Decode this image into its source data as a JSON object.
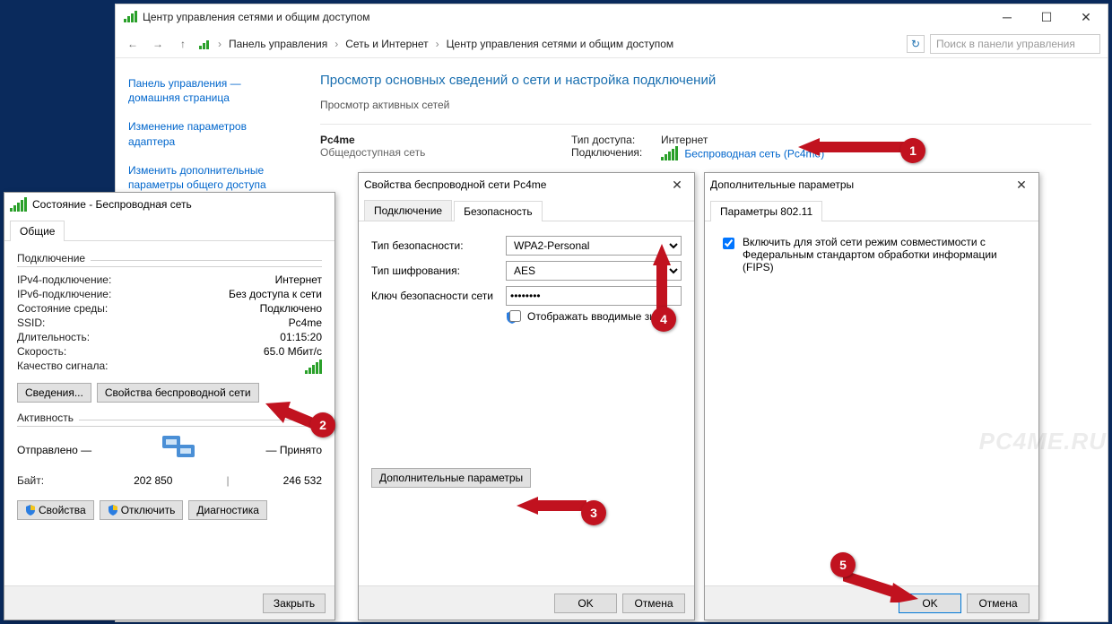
{
  "mainWindow": {
    "title": "Центр управления сетями и общим доступом",
    "breadcrumb": {
      "p1": "Панель управления",
      "p2": "Сеть и Интернет",
      "p3": "Центр управления сетями и общим доступом"
    },
    "searchPlaceholder": "Поиск в панели управления",
    "sideLinks": {
      "home": "Панель управления — домашняя страница",
      "adapter": "Изменение параметров адаптера",
      "sharing": "Изменить дополнительные параметры общего доступа"
    },
    "heading": "Просмотр основных сведений о сети и настройка подключений",
    "activeHeading": "Просмотр активных сетей",
    "network": {
      "name": "Pc4me",
      "scope": "Общедоступная сеть",
      "accessLabel": "Тип доступа:",
      "accessValue": "Интернет",
      "connLabel": "Подключения:",
      "connValue": "Беспроводная сеть (Pc4me)"
    }
  },
  "statusDlg": {
    "title": "Состояние - Беспроводная сеть",
    "tab": "Общие",
    "groupConn": "Подключение",
    "rows": {
      "ipv4k": "IPv4-подключение:",
      "ipv4v": "Интернет",
      "ipv6k": "IPv6-подключение:",
      "ipv6v": "Без доступа к сети",
      "statek": "Состояние среды:",
      "statev": "Подключено",
      "ssidk": "SSID:",
      "ssidv": "Pc4me",
      "durk": "Длительность:",
      "durv": "01:15:20",
      "speedk": "Скорость:",
      "speedv": "65.0 Мбит/с",
      "qualk": "Качество сигнала:"
    },
    "btnDetails": "Сведения...",
    "btnWlanProps": "Свойства беспроводной сети",
    "groupAct": "Активность",
    "sentLabel": "Отправлено",
    "recvLabel": "Принято",
    "bytesLabel": "Байт:",
    "sent": "202 850",
    "recv": "246 532",
    "btnProps": "Свойства",
    "btnDisable": "Отключить",
    "btnDiag": "Диагностика",
    "btnClose": "Закрыть"
  },
  "propsDlg": {
    "title": "Свойства беспроводной сети Pc4me",
    "tabConn": "Подключение",
    "tabSec": "Безопасность",
    "secTypeLabel": "Тип безопасности:",
    "secTypeVal": "WPA2-Personal",
    "encLabel": "Тип шифрования:",
    "encVal": "AES",
    "keyLabel": "Ключ безопасности сети",
    "keyVal": "••••••••",
    "showChars": "Отображать вводимые знаки",
    "btnAdvanced": "Дополнительные параметры",
    "btnOK": "OK",
    "btnCancel": "Отмена"
  },
  "advDlg": {
    "title": "Дополнительные параметры",
    "tab": "Параметры 802.11",
    "fipsLabel": "Включить для этой сети режим совместимости с Федеральным стандартом обработки информации (FIPS)",
    "btnOK": "OK",
    "btnCancel": "Отмена"
  },
  "badges": {
    "b1": "1",
    "b2": "2",
    "b3": "3",
    "b4": "4",
    "b5": "5"
  },
  "watermark": "PC4ME.RU"
}
